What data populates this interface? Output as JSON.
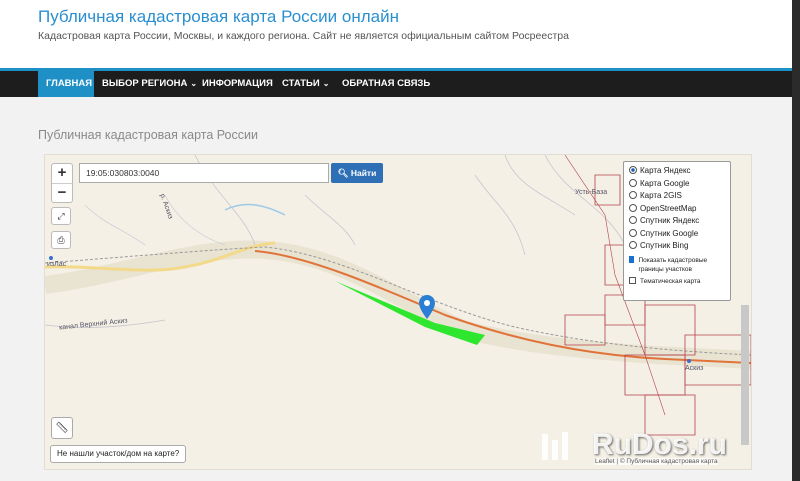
{
  "site": {
    "title": "Публичная кадастровая карта России онлайн",
    "description": "Кадастровая карта России, Москвы, и каждого региона. Сайт не является официальным сайтом Росреестра"
  },
  "nav": {
    "items": [
      {
        "label": "ГЛАВНАЯ",
        "active": true
      },
      {
        "label": "ВЫБОР РЕГИОНА",
        "has_dropdown": true
      },
      {
        "label": "ИНФОРМАЦИЯ"
      },
      {
        "label": "СТАТЬИ",
        "has_dropdown": true
      },
      {
        "label": "ОБРАТНАЯ СВЯЗЬ"
      }
    ]
  },
  "page": {
    "heading": "Публичная кадастровая карта России"
  },
  "map": {
    "search": {
      "value": "19:05:030803:0040",
      "button_label": "Найти"
    },
    "zoom": {
      "plus": "+",
      "minus": "−"
    },
    "layers": [
      {
        "label": "Карта Яндекс",
        "selected": true
      },
      {
        "label": "Карта Google",
        "selected": false
      },
      {
        "label": "Карта 2GIS",
        "selected": false
      },
      {
        "label": "OpenStreetMap",
        "selected": false
      },
      {
        "label": "Спутник Яндекс",
        "selected": false
      },
      {
        "label": "Спутник Google",
        "selected": false
      },
      {
        "label": "Спутник Bing",
        "selected": false
      }
    ],
    "options": [
      {
        "label": "Показать кадастровые границы участков",
        "checked": true
      },
      {
        "label": "Тематическая карта",
        "checked": false
      }
    ],
    "labels": {
      "ust_baza": "Усть-База",
      "askiz": "Аскиз",
      "river_askiz": "р. Аскиз",
      "izlas": "изЛас",
      "verkhniy_askiz": "канал Верхний Аскиз"
    },
    "not_found_label": "Не нашли участок/дом на карте?",
    "attribution": "Leaflet | © Публичная кадастровая карта"
  },
  "watermark": "RuDos.ru",
  "colors": {
    "accent": "#1e90c6",
    "nav_bg": "#1d1d1d",
    "parcel": "#2ee62e",
    "road": "#e0733a",
    "boundary": "#b5404a"
  }
}
